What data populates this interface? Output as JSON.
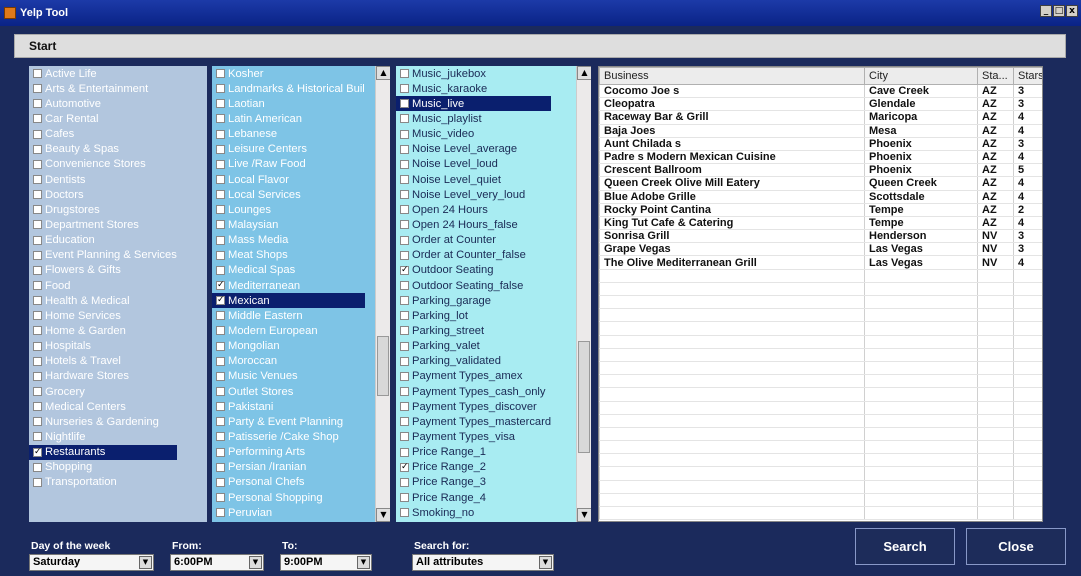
{
  "window": {
    "title": "Yelp Tool",
    "minimize": "_",
    "restore": "□",
    "close": "x"
  },
  "tabs": [
    "Start"
  ],
  "categories": {
    "items": [
      "Active Life",
      "Arts & Entertainment",
      "Automotive",
      "Car Rental",
      "Cafes",
      "Beauty & Spas",
      "Convenience Stores",
      "Dentists",
      "Doctors",
      "Drugstores",
      "Department Stores",
      "Education",
      "Event Planning & Services",
      "Flowers & Gifts",
      "Food",
      "Health & Medical",
      "Home Services",
      "Home & Garden",
      "Hospitals",
      "Hotels & Travel",
      "Hardware Stores",
      "Grocery",
      "Medical Centers",
      "Nurseries & Gardening",
      "Nightlife",
      "Restaurants",
      "Shopping",
      "Transportation"
    ],
    "checked_index": 25,
    "selected_index": 25
  },
  "subcategories": {
    "items": [
      "Kosher",
      "Landmarks & Historical Buil",
      "Laotian",
      "Latin American",
      "Lebanese",
      "Leisure Centers",
      "Live /Raw Food",
      "Local Flavor",
      "Local Services",
      "Lounges",
      "Malaysian",
      "Mass Media",
      "Meat Shops",
      "Medical Spas",
      "Mediterranean",
      "Mexican",
      "Middle Eastern",
      "Modern European",
      "Mongolian",
      "Moroccan",
      "Music Venues",
      "Outlet Stores",
      "Pakistani",
      "Party & Event Planning",
      "Patisserie /Cake Shop",
      "Performing Arts",
      "Persian /Iranian",
      "Personal Chefs",
      "Personal Shopping",
      "Peruvian"
    ],
    "checked_indices": [
      14,
      15
    ],
    "selected_index": 15
  },
  "attributes": {
    "items": [
      "Music_jukebox",
      "Music_karaoke",
      "Music_live",
      "Music_playlist",
      "Music_video",
      "Noise Level_average",
      "Noise Level_loud",
      "Noise Level_quiet",
      "Noise Level_very_loud",
      "Open 24 Hours",
      "Open 24 Hours_false",
      "Order at Counter",
      "Order at Counter_false",
      "Outdoor Seating",
      "Outdoor Seating_false",
      "Parking_garage",
      "Parking_lot",
      "Parking_street",
      "Parking_valet",
      "Parking_validated",
      "Payment Types_amex",
      "Payment Types_cash_only",
      "Payment Types_discover",
      "Payment Types_mastercard",
      "Payment Types_visa",
      "Price Range_1",
      "Price Range_2",
      "Price Range_3",
      "Price Range_4",
      "Smoking_no"
    ],
    "checked_indices": [
      13,
      26
    ],
    "selected_index": 2
  },
  "results": {
    "columns": [
      "Business",
      "City",
      "Sta...",
      "Stars"
    ],
    "rows": [
      [
        "Cocomo Joe s",
        "Cave Creek",
        "AZ",
        "3"
      ],
      [
        "Cleopatra",
        "Glendale",
        "AZ",
        "3"
      ],
      [
        "Raceway Bar & Grill",
        "Maricopa",
        "AZ",
        "4"
      ],
      [
        "Baja Joes",
        "Mesa",
        "AZ",
        "4"
      ],
      [
        "Aunt Chilada s",
        "Phoenix",
        "AZ",
        "3"
      ],
      [
        "Padre s Modern Mexican Cuisine",
        "Phoenix",
        "AZ",
        "4"
      ],
      [
        "Crescent Ballroom",
        "Phoenix",
        "AZ",
        "5"
      ],
      [
        "Queen Creek Olive Mill Eatery",
        "Queen Creek",
        "AZ",
        "4"
      ],
      [
        "Blue Adobe Grille",
        "Scottsdale",
        "AZ",
        "4"
      ],
      [
        "Rocky Point Cantina",
        "Tempe",
        "AZ",
        "2"
      ],
      [
        "King Tut Cafe & Catering",
        "Tempe",
        "AZ",
        "4"
      ],
      [
        "Sonrisa Grill",
        "Henderson",
        "NV",
        "3"
      ],
      [
        "Grape Vegas",
        "Las Vegas",
        "NV",
        "3"
      ],
      [
        "The Olive Mediterranean Grill",
        "Las Vegas",
        "NV",
        "4"
      ]
    ],
    "empty_rows": 19
  },
  "filters": {
    "day_label": "Day of the week",
    "day_value": "Saturday",
    "from_label": "From:",
    "from_value": "6:00PM",
    "to_label": "To:",
    "to_value": "9:00PM",
    "search_for_label": "Search for:",
    "search_for_value": "All attributes"
  },
  "actions": {
    "search": "Search",
    "close": "Close"
  },
  "colors": {
    "background": "#1b2a5c",
    "selection": "#0a1f6e",
    "categories_bg": "#b2c6de",
    "subcategories_bg": "#7ec4e6",
    "attributes_bg": "#a8ecf2"
  }
}
